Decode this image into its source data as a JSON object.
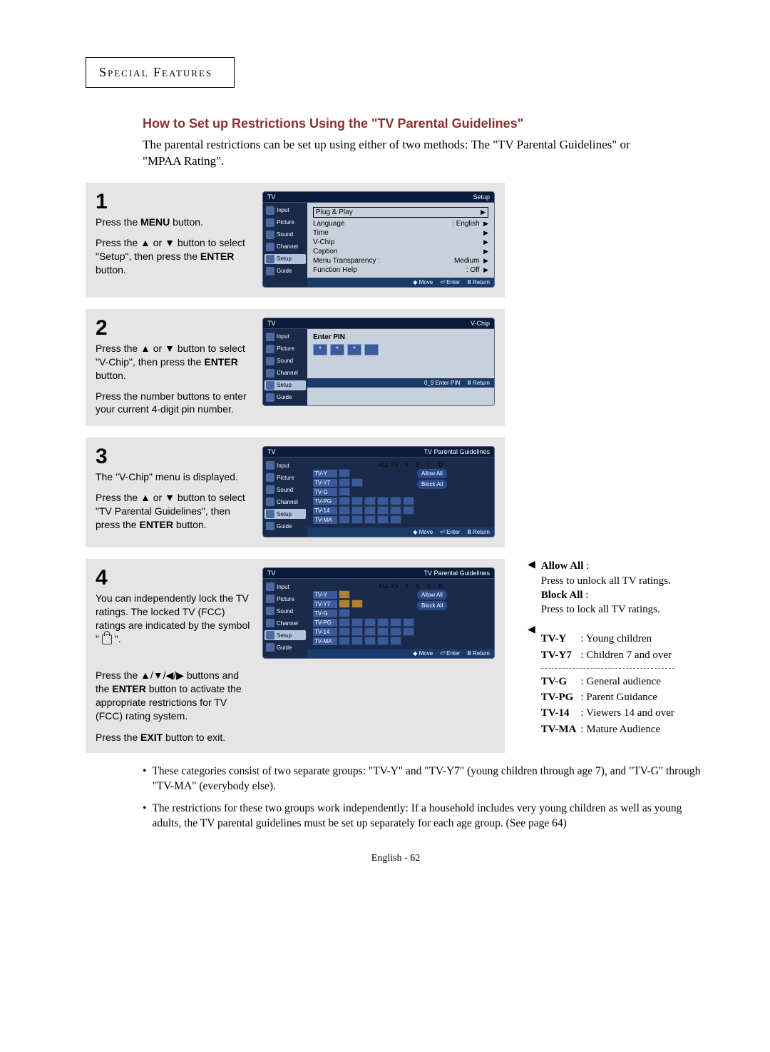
{
  "header": {
    "label": "Special Features"
  },
  "title": "How to Set up Restrictions Using the \"TV Parental Guidelines\"",
  "intro": "The parental restrictions can be set up using either of two methods: The \"TV Parental Guidelines\" or \"MPAA Rating\".",
  "steps": {
    "s1": {
      "num": "1",
      "text_a": "Press the ",
      "text_a_bold": "MENU",
      "text_a_tail": " button.",
      "text_b": "Press the ▲ or ▼ button to select \"Setup\", then press the ",
      "text_b_bold": "ENTER",
      "text_b_tail": " button."
    },
    "s2": {
      "num": "2",
      "text_a": "Press the ▲ or ▼ button to select \"V-Chip\", then press the ",
      "text_a_bold": "ENTER",
      "text_a_tail": " button.",
      "text_b": "Press the number buttons to enter your current 4-digit pin number."
    },
    "s3": {
      "num": "3",
      "text_a": "The \"V-Chip\" menu is displayed.",
      "text_b": "Press the ▲ or ▼ button to select \"TV Parental Guidelines\", then press the ",
      "text_b_bold": "ENTER",
      "text_b_tail": " button."
    },
    "s4": {
      "num": "4",
      "text_a": "You can independently lock the TV ratings. The locked TV (FCC) ratings are indicated by the symbol \" ",
      "text_a_tail": " \".",
      "text_b": "Press the ▲/▼/◀/▶ buttons and the ",
      "text_b_bold": "ENTER",
      "text_b_tail": " button to activate the appropriate restrictions for TV (FCC) rating system.",
      "text_c": "Press the ",
      "text_c_bold": "EXIT",
      "text_c_tail": " button to exit."
    }
  },
  "osd": {
    "tv": "TV",
    "side": {
      "input": "Input",
      "picture": "Picture",
      "sound": "Sound",
      "channel": "Channel",
      "setup": "Setup",
      "guide": "Guide"
    },
    "setup": {
      "title": "Setup",
      "items": {
        "plug": "Plug & Play",
        "language": "Language",
        "language_val": ": English",
        "time": "Time",
        "vchip": "V-Chip",
        "caption": "Caption",
        "trans": "Menu Transparency :",
        "trans_val": "Medium",
        "func": "Function Help",
        "func_val": ": Off"
      },
      "foot": {
        "move": "Move",
        "enter": "Enter",
        "return": "Return"
      }
    },
    "vchip": {
      "title": "V-Chip",
      "enter_pin": "Enter PIN",
      "star": "*",
      "foot": {
        "enter": "0_9 Enter PIN",
        "return": "Return"
      }
    },
    "tvpg": {
      "title": "TV Parental Guidelines",
      "cols": {
        "all": "ALL",
        "fv": "FV",
        "v": "V",
        "s": "S",
        "l": "L",
        "d": "D"
      },
      "rows": {
        "tvy": "TV-Y",
        "tvy7": "TV-Y7",
        "tvg": "TV-G",
        "tvpg": "TV-PG",
        "tv14": "TV-14",
        "tvma": "TV-MA"
      },
      "allow": "Allow All",
      "block": "Block All",
      "foot": {
        "move": "Move",
        "enter": "Enter",
        "return": "Return"
      }
    }
  },
  "notes": {
    "allow_title": "Allow All",
    "allow_desc": "Press to unlock all TV ratings.",
    "block_title": "Block All",
    "block_desc": "Press to lock all TV ratings.",
    "r": {
      "tvy": {
        "k": "TV-Y",
        "v": ": Young children"
      },
      "tvy7": {
        "k": "TV-Y7",
        "v": ": Children 7 and over"
      },
      "tvg": {
        "k": "TV-G",
        "v": ": General audience"
      },
      "tvpg": {
        "k": "TV-PG",
        "v": ": Parent Guidance"
      },
      "tv14": {
        "k": "TV-14",
        "v": ": Viewers 14 and over"
      },
      "tvma": {
        "k": "TV-MA",
        "v": ": Mature Audience"
      }
    }
  },
  "bullets": {
    "b1": "These categories consist of two separate groups: \"TV-Y\" and \"TV-Y7\" (young children through age 7), and \"TV-G\" through \"TV-MA\" (everybody else).",
    "b2": "The restrictions for these two groups work independently: If a household includes very young children as well as young adults, the TV parental guidelines must be set up separately for each age group. (See page 64)"
  },
  "footer": "English - 62"
}
